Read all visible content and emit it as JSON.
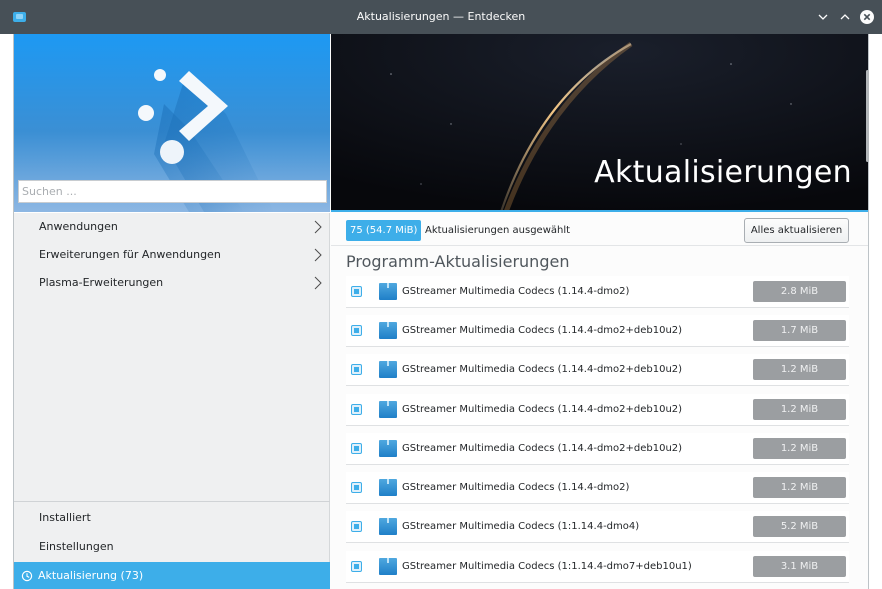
{
  "window": {
    "title": "Aktualisierungen — Entdecken"
  },
  "sidebar": {
    "search_placeholder": "Suchen ...",
    "categories": [
      {
        "label": "Anwendungen"
      },
      {
        "label": "Erweiterungen für Anwendungen"
      },
      {
        "label": "Plasma-Erweiterungen"
      }
    ],
    "bottom": {
      "installed": "Installiert",
      "settings": "Einstellungen",
      "updates": "Aktualisierung (73)"
    }
  },
  "banner": {
    "title": "Aktualisierungen"
  },
  "summary": {
    "count_badge": "75 (54.7 MiB)",
    "text": "Aktualisierungen ausgewählt",
    "update_all": "Alles aktualisieren"
  },
  "section": {
    "title": "Programm-Aktualisierungen"
  },
  "updates": [
    {
      "name": "GStreamer Multimedia Codecs (1.14.4-dmo2)",
      "size": "2.8 MiB",
      "checked": true
    },
    {
      "name": "GStreamer Multimedia Codecs (1.14.4-dmo2+deb10u2)",
      "size": "1.7 MiB",
      "checked": true
    },
    {
      "name": "GStreamer Multimedia Codecs (1.14.4-dmo2+deb10u2)",
      "size": "1.2 MiB",
      "checked": true
    },
    {
      "name": "GStreamer Multimedia Codecs (1.14.4-dmo2+deb10u2)",
      "size": "1.2 MiB",
      "checked": true
    },
    {
      "name": "GStreamer Multimedia Codecs (1.14.4-dmo2+deb10u2)",
      "size": "1.2 MiB",
      "checked": true
    },
    {
      "name": "GStreamer Multimedia Codecs (1.14.4-dmo2)",
      "size": "1.2 MiB",
      "checked": true
    },
    {
      "name": "GStreamer Multimedia Codecs (1:1.14.4-dmo4)",
      "size": "5.2 MiB",
      "checked": true
    },
    {
      "name": "GStreamer Multimedia Codecs (1:1.14.4-dmo7+deb10u1)",
      "size": "3.1 MiB",
      "checked": true
    }
  ],
  "colors": {
    "accent": "#3daee9",
    "titlebar": "#475057",
    "size_badge": "#9b9ea1"
  },
  "icons": {
    "app": "discover-icon",
    "minimize": "chevron-down-icon",
    "maximize": "chevron-up-icon",
    "close": "close-circle-icon",
    "category_arrow": "chevron-right-icon",
    "updates": "update-sync-icon",
    "package": "package-icon"
  }
}
